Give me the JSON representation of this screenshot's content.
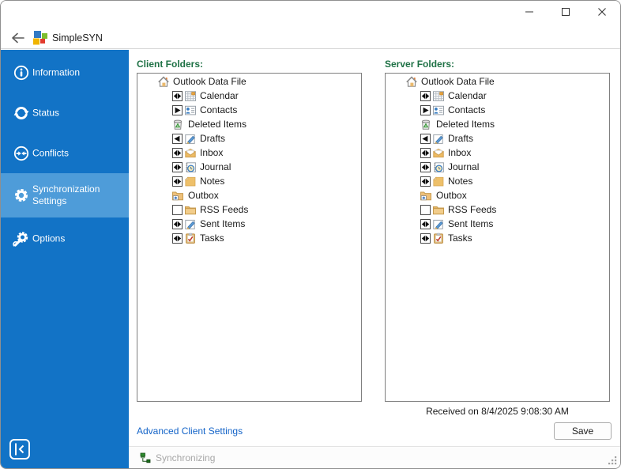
{
  "titlebar": {
    "title": "SimpleSYN",
    "back_tooltip": "Back",
    "controls": {
      "minimize": "minimize",
      "maximize": "maximize",
      "close": "close"
    }
  },
  "sidebar": {
    "bg_color": "#1273C6",
    "selected_bg_color": "#4E9CD9",
    "items": [
      {
        "label": "Information",
        "icon": "information-icon",
        "selected": false
      },
      {
        "label": "Status",
        "icon": "status-sync-icon",
        "selected": false
      },
      {
        "label": "Conflicts",
        "icon": "conflicts-icon",
        "selected": false
      },
      {
        "label": "Synchronization Settings",
        "icon": "gear-icon",
        "selected": true
      },
      {
        "label": "Options",
        "icon": "options-gear-icon",
        "selected": false
      }
    ]
  },
  "main": {
    "client_label": "Client Folders:",
    "server_label": "Server Folders:",
    "label_color": "#1E7145",
    "received_text": "Received on 8/4/2025 9:08:30 AM",
    "advanced_link": "Advanced Client Settings",
    "save_button": "Save"
  },
  "folders": {
    "items": [
      {
        "name": "Outlook Data File",
        "icon": "home-icon",
        "checkbox": null,
        "level": 0
      },
      {
        "name": "Calendar",
        "icon": "calendar-icon",
        "checkbox": "both",
        "level": 1
      },
      {
        "name": "Contacts",
        "icon": "contacts-icon",
        "checkbox": "to-server",
        "level": 1
      },
      {
        "name": "Deleted Items",
        "icon": "deleted-items-icon",
        "checkbox": null,
        "level": 1
      },
      {
        "name": "Drafts",
        "icon": "drafts-icon",
        "checkbox": "from-server",
        "level": 1
      },
      {
        "name": "Inbox",
        "icon": "inbox-icon",
        "checkbox": "both",
        "level": 1
      },
      {
        "name": "Journal",
        "icon": "journal-icon",
        "checkbox": "both",
        "level": 1
      },
      {
        "name": "Notes",
        "icon": "notes-icon",
        "checkbox": "both",
        "level": 1
      },
      {
        "name": "Outbox",
        "icon": "outbox-icon",
        "checkbox": null,
        "level": 1
      },
      {
        "name": "RSS Feeds",
        "icon": "folder-icon",
        "checkbox": "none",
        "level": 1
      },
      {
        "name": "Sent Items",
        "icon": "sent-items-icon",
        "checkbox": "both",
        "level": 1
      },
      {
        "name": "Tasks",
        "icon": "tasks-icon",
        "checkbox": "both",
        "level": 1
      }
    ]
  },
  "statusbar": {
    "text": "Synchronizing",
    "icon": "network-icon"
  }
}
